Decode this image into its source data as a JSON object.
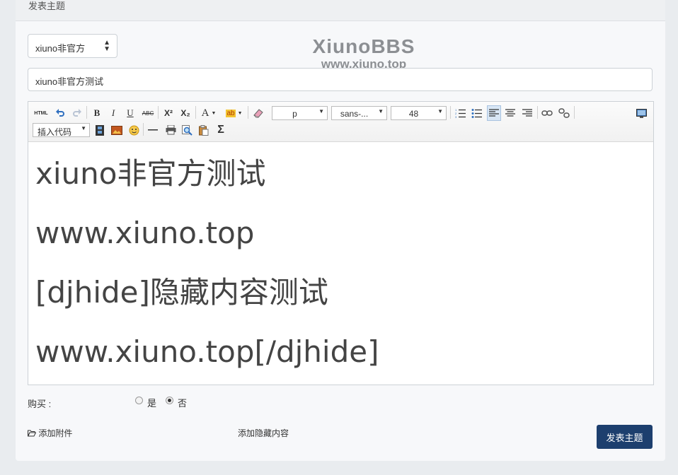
{
  "header": {
    "title": "发表主题"
  },
  "forum_select": {
    "value": "xiuno非官方"
  },
  "watermark": {
    "line1": "XiunoBBS",
    "line2": "www.xiuno.top"
  },
  "subject": {
    "value": "xiuno非官方测试"
  },
  "toolbar": {
    "html_label": "HTML",
    "bold": "B",
    "italic": "I",
    "underline": "U",
    "strike": "ABC",
    "superscript": "X²",
    "subscript": "X₂",
    "font_color": "A",
    "highlight": "ab",
    "paragraph_format": "p",
    "font_family": "sans-...",
    "font_size": "48",
    "insert_code": "插入代码",
    "formula": "Σ"
  },
  "editor": {
    "lines": [
      "xiuno非官方测试",
      "www.xiuno.top",
      "[djhide]隐藏内容测试",
      "www.xiuno.top[/djhide]"
    ]
  },
  "purchase": {
    "label": "购买 :",
    "option_yes": "是",
    "option_no": "否",
    "selected": "否"
  },
  "footer": {
    "attach_label": "添加附件",
    "hidden_label": "添加隐藏内容",
    "submit_label": "发表主题"
  }
}
